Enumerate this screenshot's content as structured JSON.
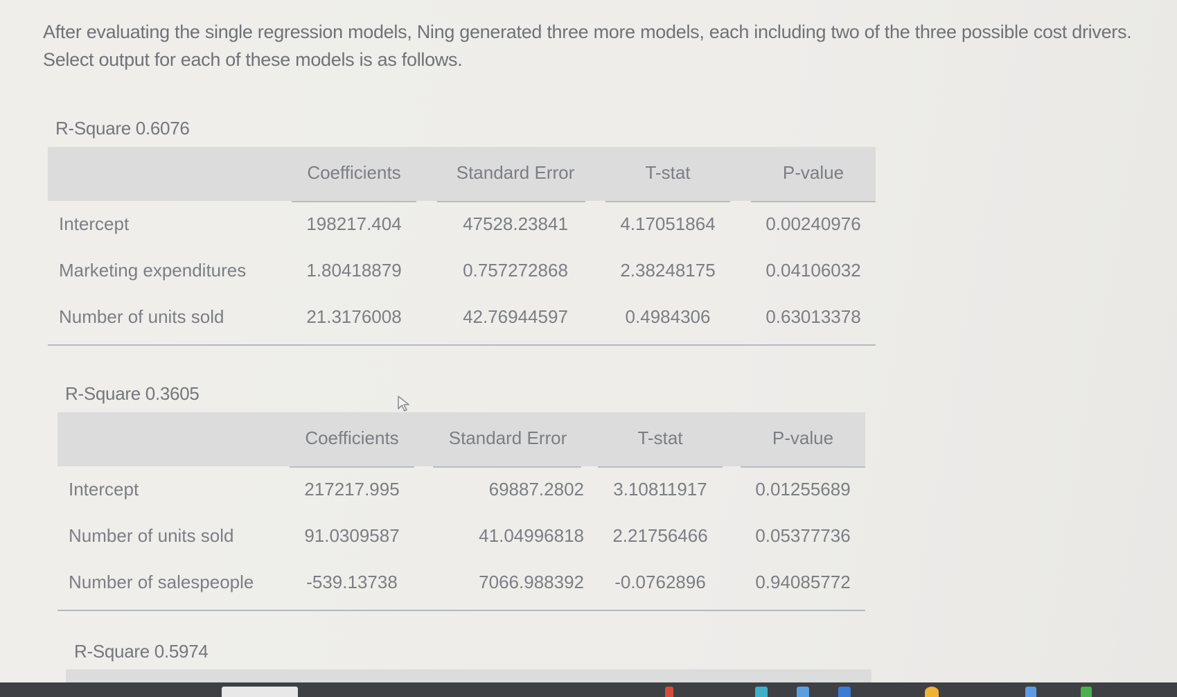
{
  "intro_text": "After evaluating the single regression models, Ning generated three more models, each including two of the three possible cost drivers. Select output for each of these models is as follows.",
  "models": [
    {
      "r_square_label": "R-Square 0.6076",
      "headers": [
        "",
        "Coefficients",
        "Standard Error",
        "T-stat",
        "P-value"
      ],
      "rows": [
        {
          "label": "Intercept",
          "values": [
            "198217.404",
            "47528.23841",
            "4.17051864",
            "0.00240976"
          ]
        },
        {
          "label": "Marketing expenditures",
          "values": [
            "1.80418879",
            "0.757272868",
            "2.38248175",
            "0.04106032"
          ]
        },
        {
          "label": "Number of units sold",
          "values": [
            "21.3176008",
            "42.76944597",
            "0.4984306",
            "0.63013378"
          ]
        }
      ]
    },
    {
      "r_square_label": "R-Square 0.3605",
      "headers": [
        "",
        "Coefficients",
        "Standard Error",
        "T-stat",
        "P-value"
      ],
      "rows": [
        {
          "label": "Intercept",
          "values": [
            "217217.995",
            "69887.2802",
            "3.10811917",
            "0.01255689"
          ]
        },
        {
          "label": "Number of units sold",
          "values": [
            "91.0309587",
            "41.04996818",
            "2.21756466",
            "0.05377736"
          ]
        },
        {
          "label": "Number of salespeople",
          "values": [
            "-539.13738",
            "7066.988392",
            "-0.0762896",
            "0.94085772"
          ]
        }
      ]
    },
    {
      "r_square_label": "R-Square 0.5974"
    }
  ],
  "colors": {
    "header_bg": "#dcdcdc",
    "text": "#7b7e83",
    "page_bg": "#eeedea",
    "taskbar": "#3e4044"
  }
}
